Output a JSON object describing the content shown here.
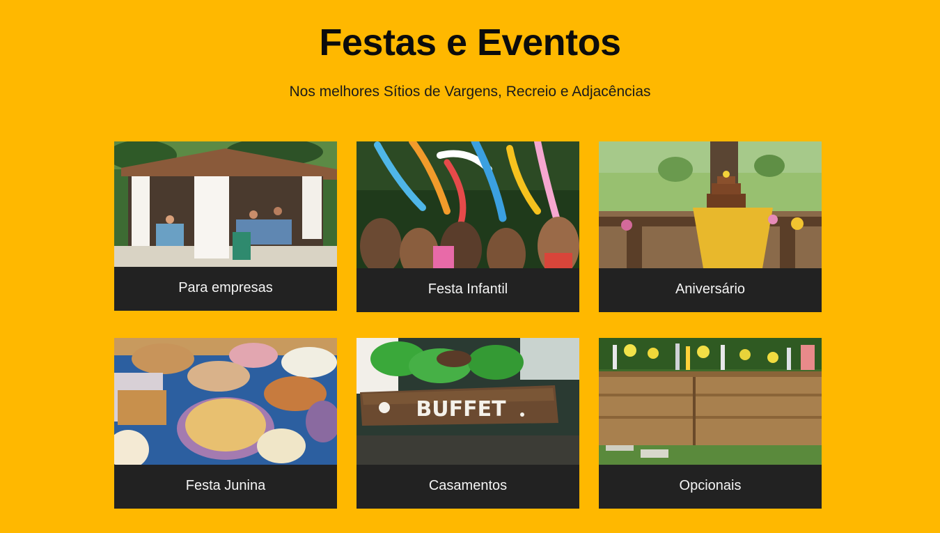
{
  "header": {
    "title": "Festas e Eventos",
    "subtitle": "Nos melhores Sítios de Vargens, Recreio e Adjacências"
  },
  "cards": [
    {
      "label": "Para empresas",
      "image": "gazebo-party-photo"
    },
    {
      "label": "Festa Infantil",
      "image": "balloon-kids-photo"
    },
    {
      "label": "Aniversário",
      "image": "birthday-cake-table-photo"
    },
    {
      "label": "Festa Junina",
      "image": "junina-food-table-photo"
    },
    {
      "label": "Casamentos",
      "image": "buffet-sign-photo",
      "image_text": "BUFFET"
    },
    {
      "label": "Opcionais",
      "image": "wooden-bar-counter-photo"
    }
  ]
}
